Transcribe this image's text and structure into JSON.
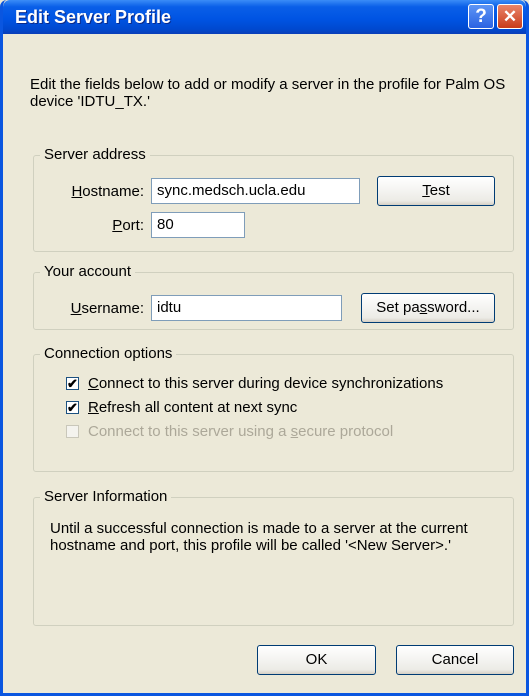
{
  "window": {
    "title": "Edit Server Profile",
    "help_glyph": "?",
    "close_glyph": "✕"
  },
  "intro_text": "Edit the fields below to add or modify a server in the profile for Palm OS device 'IDTU_TX.'",
  "server_address": {
    "legend": "Server address",
    "hostname_label_u": "H",
    "hostname_label_rest": "ostname:",
    "hostname_value": "sync.medsch.ucla.edu",
    "port_label_u": "P",
    "port_label_rest": "ort:",
    "port_value": "80",
    "test_button_u": "T",
    "test_button_rest": "est"
  },
  "account": {
    "legend": "Your account",
    "username_label_u": "U",
    "username_label_rest": "sername:",
    "username_value": "idtu",
    "set_password_pre": "Set pa",
    "set_password_u": "s",
    "set_password_post": "sword..."
  },
  "connection": {
    "legend": "Connection options",
    "opt1_u": "C",
    "opt1_rest": "onnect to this server during device synchronizations",
    "opt1_checked": true,
    "opt2_u": "R",
    "opt2_rest": "efresh all content at next sync",
    "opt2_checked": true,
    "opt3_pre": "Connect to this server using a ",
    "opt3_u": "s",
    "opt3_post": "ecure protocol",
    "opt3_checked": false,
    "check_glyph": "✔"
  },
  "server_info": {
    "legend": "Server Information",
    "text": "Until a successful connection is made to a server at the current hostname and port, this profile will be called '<New Server>.'"
  },
  "buttons": {
    "ok": "OK",
    "cancel": "Cancel"
  }
}
